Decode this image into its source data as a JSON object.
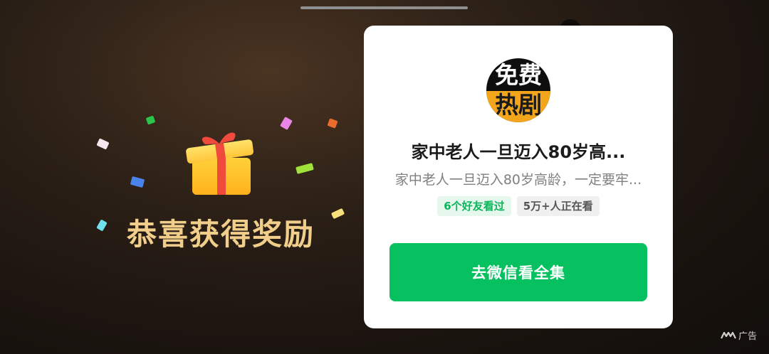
{
  "reward": {
    "text": "恭喜获得奖励"
  },
  "card": {
    "avatar": {
      "line1": "免费",
      "line2": "热剧"
    },
    "title": "家中老人一旦迈入80岁高...",
    "description": "家中老人一旦迈入80岁高龄，一定要牢...",
    "tags": [
      "6个好友看过",
      "5万+人正在看"
    ],
    "cta_label": "去微信看全集"
  },
  "ad": {
    "label": "广告"
  },
  "colors": {
    "cta": "#07c160",
    "reward_text": "#f1cf8b",
    "avatar_band": "#f3a51c"
  }
}
